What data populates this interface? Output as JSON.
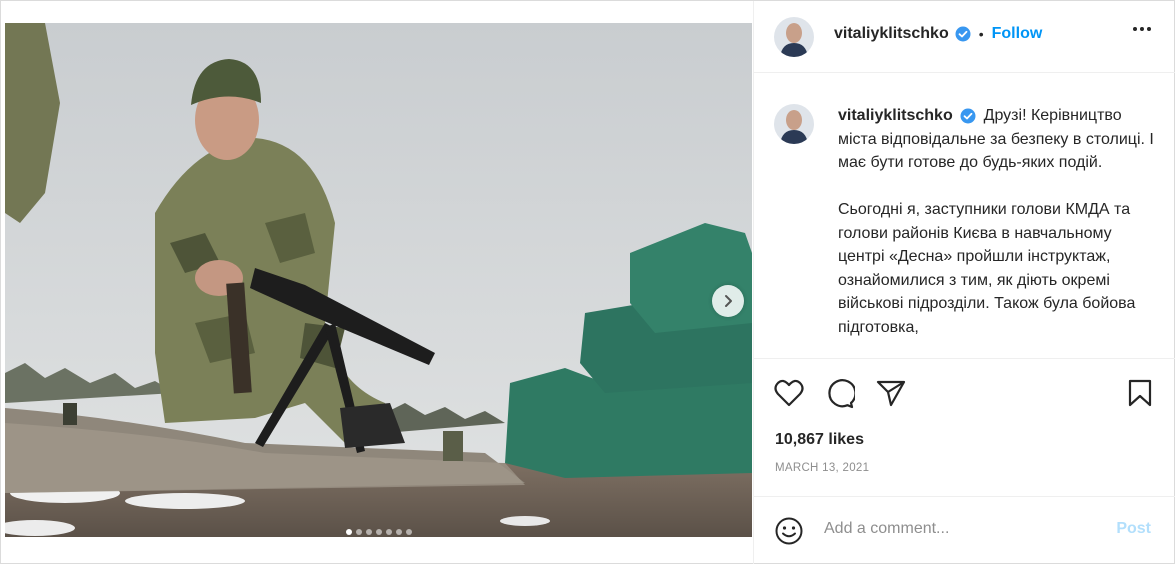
{
  "post": {
    "username": "vitaliyklitschko",
    "verified_icon": "verified-badge-icon",
    "separator": "•",
    "follow_label": "Follow",
    "more_icon": "more-options-icon",
    "caption_paragraphs": [
      "Друзі! Керівництво міста відповідальне за безпеку в столиці. І має бути готове до будь-яких подій.",
      "Сьогодні я, заступники голови КМДА та голови районів Києва в навчальному центрі «Десна» пройшли інструктаж, ознайомилися з тим, як діють окремі військові підрозділи. Також була бойова підготовка,"
    ],
    "likes": "10,867 likes",
    "date": "MARCH 13, 2021"
  },
  "actions": {
    "like_icon": "heart-icon",
    "comment_icon": "comment-icon",
    "share_icon": "share-icon",
    "save_icon": "bookmark-icon"
  },
  "comment_box": {
    "emoji_icon": "emoji-icon",
    "placeholder": "Add a comment...",
    "post_label": "Post"
  },
  "carousel": {
    "total_slides": 7,
    "active_index": 0,
    "next_icon": "chevron-right-icon"
  },
  "colors": {
    "accent": "#0095f6",
    "post_disabled": "#b2dffc",
    "text": "#262626",
    "muted": "#8e8e8e",
    "border": "#efefef"
  }
}
